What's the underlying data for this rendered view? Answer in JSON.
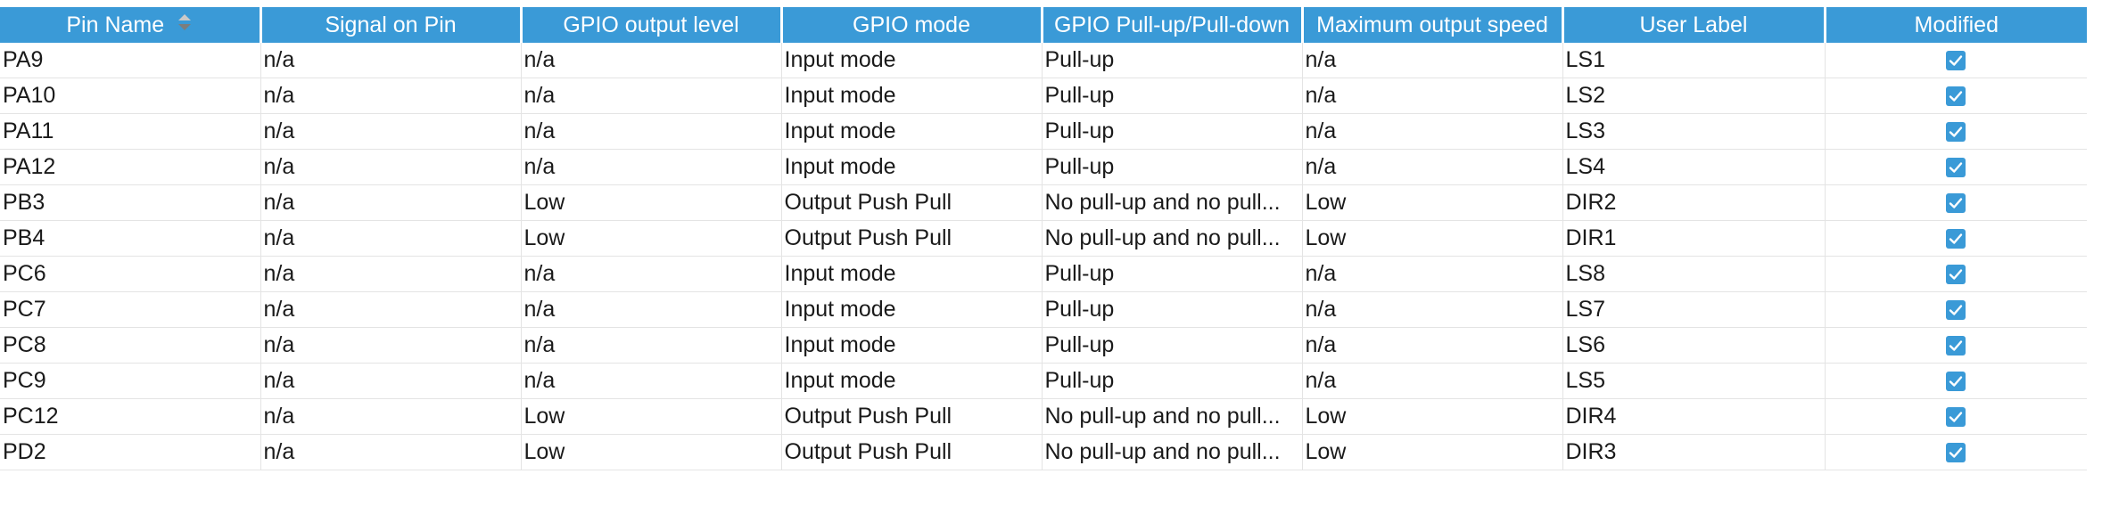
{
  "table": {
    "columns": [
      "Pin Name",
      "Signal on Pin",
      "GPIO output level",
      "GPIO mode",
      "GPIO Pull-up/Pull-down",
      "Maximum output speed",
      "User Label",
      "Modified"
    ],
    "sort_icon": "sort-arrows-icon",
    "check_icon": "checkmark-icon",
    "rows": [
      {
        "pin": "PA9",
        "signal": "n/a",
        "level": "n/a",
        "mode": "Input mode",
        "pull": "Pull-up",
        "speed": "n/a",
        "label": "LS1",
        "modified": true
      },
      {
        "pin": "PA10",
        "signal": "n/a",
        "level": "n/a",
        "mode": "Input mode",
        "pull": "Pull-up",
        "speed": "n/a",
        "label": "LS2",
        "modified": true
      },
      {
        "pin": "PA11",
        "signal": "n/a",
        "level": "n/a",
        "mode": "Input mode",
        "pull": "Pull-up",
        "speed": "n/a",
        "label": "LS3",
        "modified": true
      },
      {
        "pin": "PA12",
        "signal": "n/a",
        "level": "n/a",
        "mode": "Input mode",
        "pull": "Pull-up",
        "speed": "n/a",
        "label": "LS4",
        "modified": true
      },
      {
        "pin": "PB3",
        "signal": "n/a",
        "level": "Low",
        "mode": "Output Push Pull",
        "pull": "No pull-up and no pull...",
        "speed": "Low",
        "label": "DIR2",
        "modified": true
      },
      {
        "pin": "PB4",
        "signal": "n/a",
        "level": "Low",
        "mode": "Output Push Pull",
        "pull": "No pull-up and no pull...",
        "speed": "Low",
        "label": "DIR1",
        "modified": true
      },
      {
        "pin": "PC6",
        "signal": "n/a",
        "level": "n/a",
        "mode": "Input mode",
        "pull": "Pull-up",
        "speed": "n/a",
        "label": "LS8",
        "modified": true
      },
      {
        "pin": "PC7",
        "signal": "n/a",
        "level": "n/a",
        "mode": "Input mode",
        "pull": "Pull-up",
        "speed": "n/a",
        "label": "LS7",
        "modified": true
      },
      {
        "pin": "PC8",
        "signal": "n/a",
        "level": "n/a",
        "mode": "Input mode",
        "pull": "Pull-up",
        "speed": "n/a",
        "label": "LS6",
        "modified": true
      },
      {
        "pin": "PC9",
        "signal": "n/a",
        "level": "n/a",
        "mode": "Input mode",
        "pull": "Pull-up",
        "speed": "n/a",
        "label": "LS5",
        "modified": true
      },
      {
        "pin": "PC12",
        "signal": "n/a",
        "level": "Low",
        "mode": "Output Push Pull",
        "pull": "No pull-up and no pull...",
        "speed": "Low",
        "label": "DIR4",
        "modified": true
      },
      {
        "pin": "PD2",
        "signal": "n/a",
        "level": "Low",
        "mode": "Output Push Pull",
        "pull": "No pull-up and no pull...",
        "speed": "Low",
        "label": "DIR3",
        "modified": true
      }
    ]
  },
  "colors": {
    "header_bg": "#3a9ad7",
    "header_text": "#ffffff",
    "checkbox": "#3a9ad7",
    "grid_line": "#e4e4e4"
  }
}
